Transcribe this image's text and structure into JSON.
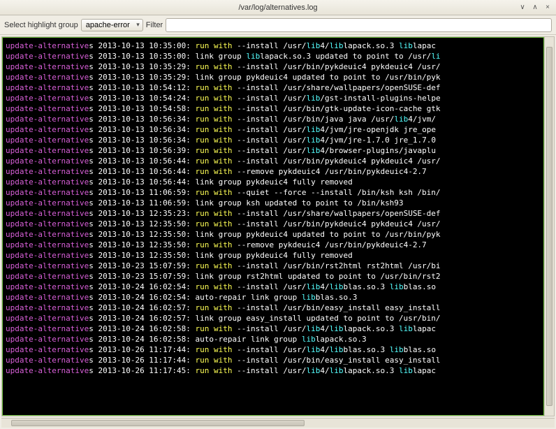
{
  "window": {
    "title": "/var/log/alternatives.log"
  },
  "toolbar": {
    "highlight_label": "Select highlight group",
    "highlight_value": "apache-error",
    "filter_label": "Filter",
    "filter_value": ""
  },
  "log_lines": [
    [
      [
        "update-alternative",
        "magenta"
      ],
      [
        "s 2013-10-13 10:35:00: ",
        "white"
      ],
      [
        "run with ",
        "yellow"
      ],
      [
        "--install /usr/",
        "white"
      ],
      [
        "lib",
        "cyan"
      ],
      [
        "4/",
        "white"
      ],
      [
        "lib",
        "cyan"
      ],
      [
        "lapack.so.3 ",
        "white"
      ],
      [
        "lib",
        "cyan"
      ],
      [
        "lapac",
        "white"
      ]
    ],
    [
      [
        "update-alternative",
        "magenta"
      ],
      [
        "s 2013-10-13 10:35:00: link group ",
        "white"
      ],
      [
        "lib",
        "cyan"
      ],
      [
        "lapack.so.3 updated to point to /usr/",
        "white"
      ],
      [
        "li",
        "cyan"
      ]
    ],
    [
      [
        "update-alternative",
        "magenta"
      ],
      [
        "s 2013-10-13 10:35:29: ",
        "white"
      ],
      [
        "run with ",
        "yellow"
      ],
      [
        "--install /usr/bin/pykdeuic4 pykdeuic4 /usr/",
        "white"
      ]
    ],
    [
      [
        "update-alternative",
        "magenta"
      ],
      [
        "s 2013-10-13 10:35:29: link group pykdeuic4 updated to point to /usr/bin/pyk",
        "white"
      ]
    ],
    [
      [
        "update-alternative",
        "magenta"
      ],
      [
        "s 2013-10-13 10:54:12: ",
        "white"
      ],
      [
        "run with ",
        "yellow"
      ],
      [
        "--install /usr/share/wallpapers/openSUSE-def",
        "white"
      ]
    ],
    [
      [
        "update-alternative",
        "magenta"
      ],
      [
        "s 2013-10-13 10:54:24: ",
        "white"
      ],
      [
        "run with ",
        "yellow"
      ],
      [
        "--install /usr/",
        "white"
      ],
      [
        "lib",
        "cyan"
      ],
      [
        "/gst-install-plugins-helpe",
        "white"
      ]
    ],
    [
      [
        "update-alternative",
        "magenta"
      ],
      [
        "s 2013-10-13 10:54:58: ",
        "white"
      ],
      [
        "run with ",
        "yellow"
      ],
      [
        "--install /usr/bin/gtk-update-icon-cache gtk",
        "white"
      ]
    ],
    [
      [
        "update-alternative",
        "magenta"
      ],
      [
        "s 2013-10-13 10:56:34: ",
        "white"
      ],
      [
        "run with ",
        "yellow"
      ],
      [
        "--install /usr/bin/java java /usr/",
        "white"
      ],
      [
        "lib",
        "cyan"
      ],
      [
        "4/jvm/",
        "white"
      ]
    ],
    [
      [
        "update-alternative",
        "magenta"
      ],
      [
        "s 2013-10-13 10:56:34: ",
        "white"
      ],
      [
        "run with ",
        "yellow"
      ],
      [
        "--install /usr/",
        "white"
      ],
      [
        "lib",
        "cyan"
      ],
      [
        "4/jvm/jre-openjdk jre_ope",
        "white"
      ]
    ],
    [
      [
        "update-alternative",
        "magenta"
      ],
      [
        "s 2013-10-13 10:56:34: ",
        "white"
      ],
      [
        "run with ",
        "yellow"
      ],
      [
        "--install /usr/",
        "white"
      ],
      [
        "lib",
        "cyan"
      ],
      [
        "4/jvm/jre-1.7.0 jre_1.7.0",
        "white"
      ]
    ],
    [
      [
        "update-alternative",
        "magenta"
      ],
      [
        "s 2013-10-13 10:56:39: ",
        "white"
      ],
      [
        "run with ",
        "yellow"
      ],
      [
        "--install /usr/",
        "white"
      ],
      [
        "lib",
        "cyan"
      ],
      [
        "4/browser-plugins/javaplu",
        "white"
      ]
    ],
    [
      [
        "update-alternative",
        "magenta"
      ],
      [
        "s 2013-10-13 10:56:44: ",
        "white"
      ],
      [
        "run with ",
        "yellow"
      ],
      [
        "--install /usr/bin/pykdeuic4 pykdeuic4 /usr/",
        "white"
      ]
    ],
    [
      [
        "update-alternative",
        "magenta"
      ],
      [
        "s 2013-10-13 10:56:44: ",
        "white"
      ],
      [
        "run with ",
        "yellow"
      ],
      [
        "--remove pykdeuic4 /usr/bin/pykdeuic4-2.7",
        "white"
      ]
    ],
    [
      [
        "update-alternative",
        "magenta"
      ],
      [
        "s 2013-10-13 10:56:44: link group pykdeuic4 fully removed",
        "white"
      ]
    ],
    [
      [
        "update-alternative",
        "magenta"
      ],
      [
        "s 2013-10-13 11:06:59: ",
        "white"
      ],
      [
        "run with ",
        "yellow"
      ],
      [
        "--quiet --force --install /bin/ksh ksh /bin/",
        "white"
      ]
    ],
    [
      [
        "update-alternative",
        "magenta"
      ],
      [
        "s 2013-10-13 11:06:59: link group ksh updated to point to /bin/ksh93",
        "white"
      ]
    ],
    [
      [
        "update-alternative",
        "magenta"
      ],
      [
        "s 2013-10-13 12:35:23: ",
        "white"
      ],
      [
        "run with ",
        "yellow"
      ],
      [
        "--install /usr/share/wallpapers/openSUSE-def",
        "white"
      ]
    ],
    [
      [
        "update-alternative",
        "magenta"
      ],
      [
        "s 2013-10-13 12:35:50: ",
        "white"
      ],
      [
        "run with ",
        "yellow"
      ],
      [
        "--install /usr/bin/pykdeuic4 pykdeuic4 /usr/",
        "white"
      ]
    ],
    [
      [
        "update-alternative",
        "magenta"
      ],
      [
        "s 2013-10-13 12:35:50: link group pykdeuic4 updated to point to /usr/bin/pyk",
        "white"
      ]
    ],
    [
      [
        "update-alternative",
        "magenta"
      ],
      [
        "s 2013-10-13 12:35:50: ",
        "white"
      ],
      [
        "run with ",
        "yellow"
      ],
      [
        "--remove pykdeuic4 /usr/bin/pykdeuic4-2.7",
        "white"
      ]
    ],
    [
      [
        "update-alternative",
        "magenta"
      ],
      [
        "s 2013-10-13 12:35:50: link group pykdeuic4 fully removed",
        "white"
      ]
    ],
    [
      [
        "update-alternative",
        "magenta"
      ],
      [
        "s 2013-10-23 15:07:59: ",
        "white"
      ],
      [
        "run with ",
        "yellow"
      ],
      [
        "--install /usr/bin/rst2html rst2html /usr/bi",
        "white"
      ]
    ],
    [
      [
        "update-alternative",
        "magenta"
      ],
      [
        "s 2013-10-23 15:07:59: link group rst2html updated to point to /usr/bin/rst2",
        "white"
      ]
    ],
    [
      [
        "update-alternative",
        "magenta"
      ],
      [
        "s 2013-10-24 16:02:54: ",
        "white"
      ],
      [
        "run with ",
        "yellow"
      ],
      [
        "--install /usr/",
        "white"
      ],
      [
        "lib",
        "cyan"
      ],
      [
        "4/",
        "white"
      ],
      [
        "lib",
        "cyan"
      ],
      [
        "blas.so.3 ",
        "white"
      ],
      [
        "lib",
        "cyan"
      ],
      [
        "blas.so",
        "white"
      ]
    ],
    [
      [
        "update-alternative",
        "magenta"
      ],
      [
        "s 2013-10-24 16:02:54: auto-repair link group ",
        "white"
      ],
      [
        "lib",
        "cyan"
      ],
      [
        "blas.so.3",
        "white"
      ]
    ],
    [
      [
        "update-alternative",
        "magenta"
      ],
      [
        "s 2013-10-24 16:02:57: ",
        "white"
      ],
      [
        "run with ",
        "yellow"
      ],
      [
        "--install /usr/bin/easy_install easy_install",
        "white"
      ]
    ],
    [
      [
        "update-alternative",
        "magenta"
      ],
      [
        "s 2013-10-24 16:02:57: link group easy_install updated to point to /usr/bin/",
        "white"
      ]
    ],
    [
      [
        "update-alternative",
        "magenta"
      ],
      [
        "s 2013-10-24 16:02:58: ",
        "white"
      ],
      [
        "run with ",
        "yellow"
      ],
      [
        "--install /usr/",
        "white"
      ],
      [
        "lib",
        "cyan"
      ],
      [
        "4/",
        "white"
      ],
      [
        "lib",
        "cyan"
      ],
      [
        "lapack.so.3 ",
        "white"
      ],
      [
        "lib",
        "cyan"
      ],
      [
        "lapac",
        "white"
      ]
    ],
    [
      [
        "update-alternative",
        "magenta"
      ],
      [
        "s 2013-10-24 16:02:58: auto-repair link group ",
        "white"
      ],
      [
        "lib",
        "cyan"
      ],
      [
        "lapack.so.3",
        "white"
      ]
    ],
    [
      [
        "update-alternative",
        "magenta"
      ],
      [
        "s 2013-10-26 11:17:44: ",
        "white"
      ],
      [
        "run with ",
        "yellow"
      ],
      [
        "--install /usr/",
        "white"
      ],
      [
        "lib",
        "cyan"
      ],
      [
        "4/",
        "white"
      ],
      [
        "lib",
        "cyan"
      ],
      [
        "blas.so.3 ",
        "white"
      ],
      [
        "lib",
        "cyan"
      ],
      [
        "blas.so",
        "white"
      ]
    ],
    [
      [
        "update-alternative",
        "magenta"
      ],
      [
        "s 2013-10-26 11:17:44: ",
        "white"
      ],
      [
        "run with ",
        "yellow"
      ],
      [
        "--install /usr/bin/easy_install easy_install",
        "white"
      ]
    ],
    [
      [
        "update-alternative",
        "magenta"
      ],
      [
        "s 2013-10-26 11:17:45: ",
        "white"
      ],
      [
        "run with ",
        "yellow"
      ],
      [
        "--install /usr/",
        "white"
      ],
      [
        "lib",
        "cyan"
      ],
      [
        "4/",
        "white"
      ],
      [
        "lib",
        "cyan"
      ],
      [
        "lapack.so.3 ",
        "white"
      ],
      [
        "lib",
        "cyan"
      ],
      [
        "lapac",
        "white"
      ]
    ]
  ]
}
